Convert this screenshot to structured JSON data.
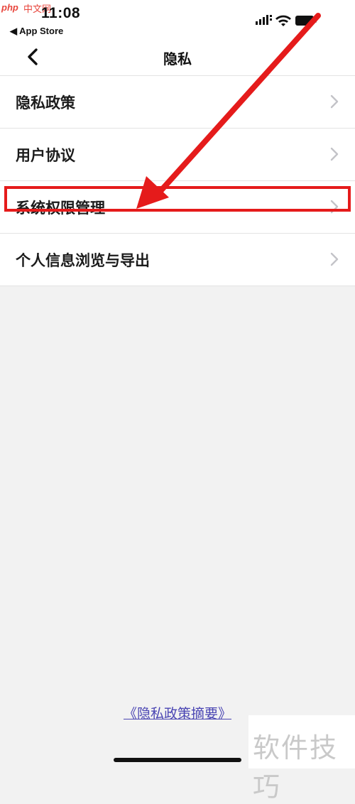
{
  "watermarks": {
    "php": "php",
    "cn": "中文网",
    "bottom": "软件技巧"
  },
  "status_bar": {
    "time": "11:08",
    "back_app": "◀ App Store",
    "icons": [
      "signal-icon",
      "wifi-icon",
      "battery-icon"
    ]
  },
  "nav": {
    "title": "隐私",
    "back_icon": "chevron-left-icon"
  },
  "list": {
    "items": [
      {
        "label": "隐私政策"
      },
      {
        "label": "用户协议"
      },
      {
        "label": "系统权限管理"
      },
      {
        "label": "个人信息浏览与导出"
      }
    ]
  },
  "footer": {
    "link": "《隐私政策摘要》"
  },
  "annotation": {
    "color": "#e51b1b",
    "highlighted_item": "系统权限管理"
  }
}
